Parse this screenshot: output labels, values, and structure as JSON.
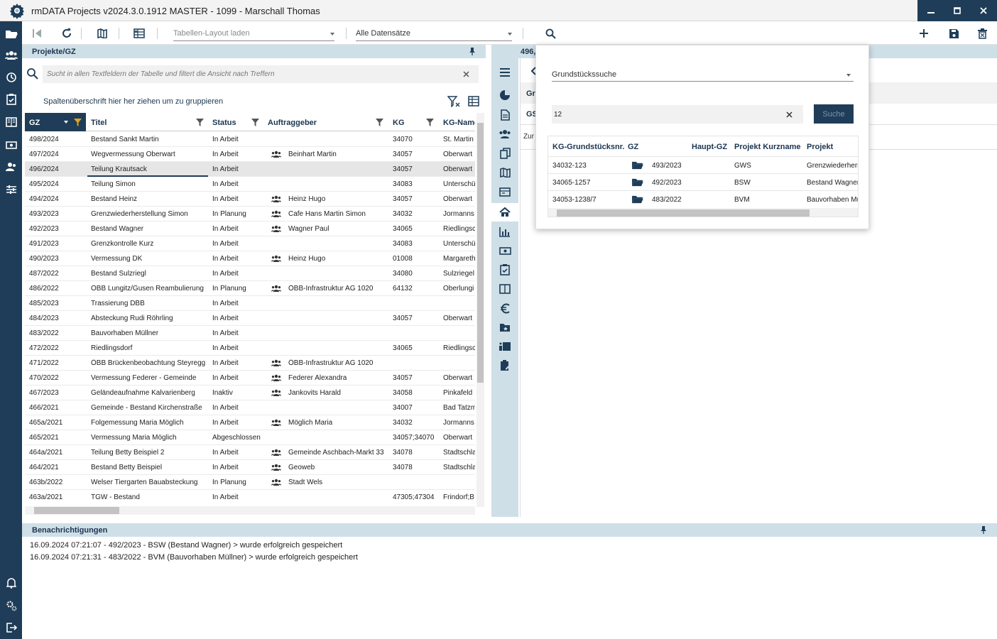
{
  "window": {
    "title": "rmDATA Projects v2024.3.0.1912 MASTER - 1099 - Marschall Thomas"
  },
  "toolbar": {
    "layout_dropdown": "Tabellen-Layout laden",
    "records_dropdown": "Alle Datensätze"
  },
  "projects_panel": {
    "title": "Projekte/GZ",
    "search_placeholder": "Sucht in allen Textfeldern der Tabelle und filtert die Ansicht nach Treffern",
    "group_hint": "Spaltenüberschrift hier her ziehen um zu gruppieren",
    "columns": [
      "GZ",
      "Titel",
      "Status",
      "Auftraggeber",
      "KG",
      "KG-Name"
    ],
    "rows": [
      {
        "gz": "498/2024",
        "titel": "Bestand Sankt Martin",
        "status": "In Arbeit",
        "auftraggeber": "",
        "kg": "34070",
        "kgname": "St. Martin"
      },
      {
        "gz": "497/2024",
        "titel": "Wegvermessung Oberwart",
        "status": "In Arbeit",
        "auftraggeber": "Beinhart Martin",
        "kg": "34057",
        "kgname": "Oberwart"
      },
      {
        "gz": "496/2024",
        "titel": "Teilung Krautsack",
        "status": "In Arbeit",
        "auftraggeber": "",
        "kg": "34057",
        "kgname": "Oberwart"
      },
      {
        "gz": "495/2024",
        "titel": "Teilung Simon",
        "status": "In Arbeit",
        "auftraggeber": "",
        "kg": "34083",
        "kgname": "Unterschü"
      },
      {
        "gz": "494/2024",
        "titel": "Bestand Heinz",
        "status": "In Arbeit",
        "auftraggeber": "Heinz Hugo",
        "kg": "34057",
        "kgname": "Oberwart"
      },
      {
        "gz": "493/2023",
        "titel": "Grenzwiederherstellung Simon",
        "status": "In Planung",
        "auftraggeber": "Cafe Hans Martin Simon",
        "kg": "34032",
        "kgname": "Jormanns"
      },
      {
        "gz": "492/2023",
        "titel": "Bestand Wagner",
        "status": "In Arbeit",
        "auftraggeber": "Wagner Paul",
        "kg": "34065",
        "kgname": "Riedlingsc"
      },
      {
        "gz": "491/2023",
        "titel": "Grenzkontrolle Kurz",
        "status": "In Arbeit",
        "auftraggeber": "",
        "kg": "34083",
        "kgname": "Unterschü"
      },
      {
        "gz": "490/2023",
        "titel": "Vermessung DK",
        "status": "In Arbeit",
        "auftraggeber": "Heinz Hugo",
        "kg": "01008",
        "kgname": "Margareth"
      },
      {
        "gz": "487/2022",
        "titel": "Bestand Sulzriegl",
        "status": "In Arbeit",
        "auftraggeber": "",
        "kg": "34080",
        "kgname": "Sulzriegel"
      },
      {
        "gz": "486/2022",
        "titel": "ÖBB Lungitz/Gusen Reambulierung",
        "status": "In Planung",
        "auftraggeber": "ÖBB-Infrastruktur AG 1020",
        "kg": "64132",
        "kgname": "Oberlungi"
      },
      {
        "gz": "485/2023",
        "titel": "Trassierung DBB",
        "status": "In Arbeit",
        "auftraggeber": "",
        "kg": "",
        "kgname": ""
      },
      {
        "gz": "484/2023",
        "titel": "Absteckung Rudi Röhrling",
        "status": "In Arbeit",
        "auftraggeber": "",
        "kg": "34057",
        "kgname": "Oberwart"
      },
      {
        "gz": "483/2022",
        "titel": "Bauvorhaben Müllner",
        "status": "In Arbeit",
        "auftraggeber": "",
        "kg": "",
        "kgname": ""
      },
      {
        "gz": "472/2022",
        "titel": "Riedlingsdorf",
        "status": "In Arbeit",
        "auftraggeber": "",
        "kg": "34065",
        "kgname": "Riedlingsc"
      },
      {
        "gz": "471/2022",
        "titel": "ÖBB Brückenbeobachtung Steyregg",
        "status": "In Arbeit",
        "auftraggeber": "ÖBB-Infrastruktur AG 1020",
        "kg": "",
        "kgname": ""
      },
      {
        "gz": "470/2022",
        "titel": "Vermessung Federer - Gemeinde",
        "status": "In Arbeit",
        "auftraggeber": "Federer Alexandra",
        "kg": "34057",
        "kgname": "Oberwart"
      },
      {
        "gz": "467/2023",
        "titel": "Geländeaufnahme Kalvarienberg",
        "status": "Inaktiv",
        "auftraggeber": "Jankovits Harald",
        "kg": "34058",
        "kgname": "Pinkafeld"
      },
      {
        "gz": "466/2021",
        "titel": "Gemeinde - Bestand Kirchenstraße",
        "status": "In Arbeit",
        "auftraggeber": "",
        "kg": "34007",
        "kgname": "Bad Tatzm"
      },
      {
        "gz": "465a/2021",
        "titel": "Folgemessung Maria Möglich",
        "status": "In Arbeit",
        "auftraggeber": "Möglich Maria",
        "kg": "34032",
        "kgname": "Jormanns"
      },
      {
        "gz": "465/2021",
        "titel": "Vermessung Maria Möglich",
        "status": "Abgeschlossen",
        "auftraggeber": "",
        "kg": "34057;34070",
        "kgname": "Oberwart"
      },
      {
        "gz": "464a/2021",
        "titel": "Teilung Betty Beispiel 2",
        "status": "In Arbeit",
        "auftraggeber": "Gemeinde Aschbach-Markt 33",
        "kg": "34078",
        "kgname": "Stadtschla"
      },
      {
        "gz": "464/2021",
        "titel": "Bestand Betty Beispiel",
        "status": "In Arbeit",
        "auftraggeber": "Geoweb",
        "kg": "34078",
        "kgname": "Stadtschla"
      },
      {
        "gz": "463b/2022",
        "titel": "Welser Tiergarten Bauabsteckung",
        "status": "In Planung",
        "auftraggeber": "Stadt Wels",
        "kg": "",
        "kgname": ""
      },
      {
        "gz": "463a/2021",
        "titel": "TGW - Bestand",
        "status": "In Arbeit",
        "auftraggeber": "",
        "kg": "47305;47304",
        "kgname": "Frindorf;B"
      }
    ]
  },
  "detail_pane": {
    "header_fragment": "496,",
    "label_gr": "Gr",
    "label_gs": "GS",
    "label_zur": "Zur"
  },
  "parcel_search": {
    "mode": "Grundstückssuche",
    "query": "12",
    "search_button": "Suche",
    "columns": [
      "KG-Grundstücksnr.",
      "GZ",
      "Haupt-GZ",
      "Projekt Kurzname",
      "Projekt"
    ],
    "results": [
      {
        "nr": "34032-123",
        "gz": "493/2023",
        "haupt": "",
        "kurz": "GWS",
        "projekt": "Grenzwiederhers"
      },
      {
        "nr": "34065-1257",
        "gz": "492/2023",
        "haupt": "",
        "kurz": "BSW",
        "projekt": "Bestand Wagner"
      },
      {
        "nr": "34053-1238/7",
        "gz": "483/2022",
        "haupt": "",
        "kurz": "BVM",
        "projekt": "Bauvorhaben Mü"
      }
    ]
  },
  "notifications": {
    "title": "Benachrichtigungen",
    "items": [
      "16.09.2024 07:21:07 - 492/2023 - BSW (Bestand Wagner) > wurde erfolgreich gespeichert",
      "16.09.2024 07:21:31 - 483/2022 - BVM (Bauvorhaben Müllner) > wurde erfolgreich gespeichert"
    ]
  },
  "colors": {
    "accent": "#1f3d58",
    "panel_header": "#cfdfe7",
    "filter_active": "#e8a317"
  }
}
